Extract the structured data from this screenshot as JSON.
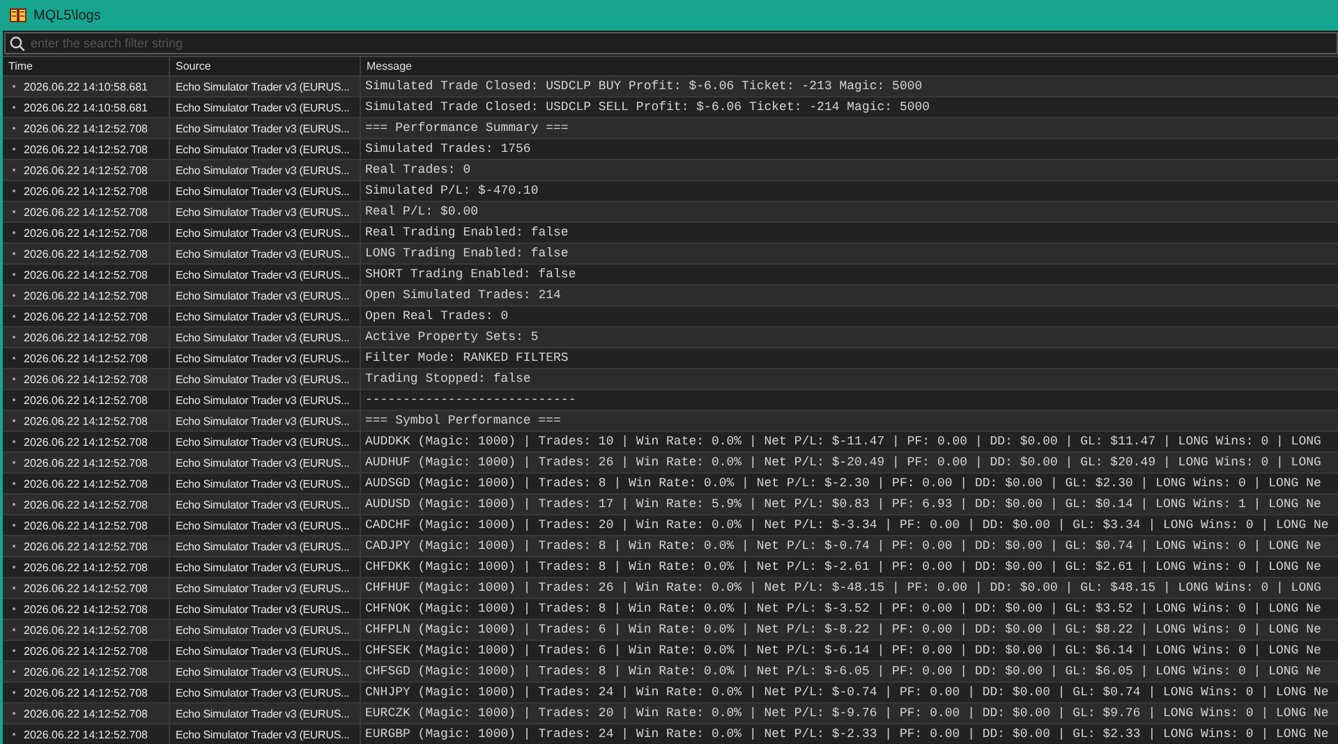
{
  "window": {
    "title": "MQL5\\logs"
  },
  "search": {
    "placeholder": "enter the search filter string"
  },
  "table": {
    "columns": [
      "Time",
      "Source",
      "Message"
    ],
    "rows": [
      {
        "time": "2026.06.22 14:10:58.681",
        "source": "Echo Simulator Trader v3 (EURUS...",
        "message": "Simulated Trade Closed: USDCLP BUY Profit: $-6.06 Ticket: -213 Magic: 5000"
      },
      {
        "time": "2026.06.22 14:10:58.681",
        "source": "Echo Simulator Trader v3 (EURUS...",
        "message": "Simulated Trade Closed: USDCLP SELL Profit: $-6.06 Ticket: -214 Magic: 5000"
      },
      {
        "time": "2026.06.22 14:12:52.708",
        "source": "Echo Simulator Trader v3 (EURUS...",
        "message": "=== Performance Summary ==="
      },
      {
        "time": "2026.06.22 14:12:52.708",
        "source": "Echo Simulator Trader v3 (EURUS...",
        "message": "Simulated Trades: 1756"
      },
      {
        "time": "2026.06.22 14:12:52.708",
        "source": "Echo Simulator Trader v3 (EURUS...",
        "message": "Real Trades: 0"
      },
      {
        "time": "2026.06.22 14:12:52.708",
        "source": "Echo Simulator Trader v3 (EURUS...",
        "message": "Simulated P/L: $-470.10"
      },
      {
        "time": "2026.06.22 14:12:52.708",
        "source": "Echo Simulator Trader v3 (EURUS...",
        "message": "Real P/L: $0.00"
      },
      {
        "time": "2026.06.22 14:12:52.708",
        "source": "Echo Simulator Trader v3 (EURUS...",
        "message": "Real Trading Enabled: false"
      },
      {
        "time": "2026.06.22 14:12:52.708",
        "source": "Echo Simulator Trader v3 (EURUS...",
        "message": "LONG Trading Enabled: false"
      },
      {
        "time": "2026.06.22 14:12:52.708",
        "source": "Echo Simulator Trader v3 (EURUS...",
        "message": "SHORT Trading Enabled: false"
      },
      {
        "time": "2026.06.22 14:12:52.708",
        "source": "Echo Simulator Trader v3 (EURUS...",
        "message": "Open Simulated Trades: 214"
      },
      {
        "time": "2026.06.22 14:12:52.708",
        "source": "Echo Simulator Trader v3 (EURUS...",
        "message": "Open Real Trades: 0"
      },
      {
        "time": "2026.06.22 14:12:52.708",
        "source": "Echo Simulator Trader v3 (EURUS...",
        "message": "Active Property Sets: 5"
      },
      {
        "time": "2026.06.22 14:12:52.708",
        "source": "Echo Simulator Trader v3 (EURUS...",
        "message": "Filter Mode: RANKED FILTERS"
      },
      {
        "time": "2026.06.22 14:12:52.708",
        "source": "Echo Simulator Trader v3 (EURUS...",
        "message": "Trading Stopped: false"
      },
      {
        "time": "2026.06.22 14:12:52.708",
        "source": "Echo Simulator Trader v3 (EURUS...",
        "message": "----------------------------"
      },
      {
        "time": "2026.06.22 14:12:52.708",
        "source": "Echo Simulator Trader v3 (EURUS...",
        "message": "=== Symbol Performance ==="
      },
      {
        "time": "2026.06.22 14:12:52.708",
        "source": "Echo Simulator Trader v3 (EURUS...",
        "message": "AUDDKK (Magic: 1000) | Trades: 10 | Win Rate: 0.0% | Net P/L: $-11.47 | PF: 0.00 | DD: $0.00 | GL: $11.47 | LONG Wins: 0 | LONG"
      },
      {
        "time": "2026.06.22 14:12:52.708",
        "source": "Echo Simulator Trader v3 (EURUS...",
        "message": "AUDHUF (Magic: 1000) | Trades: 26 | Win Rate: 0.0% | Net P/L: $-20.49 | PF: 0.00 | DD: $0.00 | GL: $20.49 | LONG Wins: 0 | LONG"
      },
      {
        "time": "2026.06.22 14:12:52.708",
        "source": "Echo Simulator Trader v3 (EURUS...",
        "message": "AUDSGD (Magic: 1000) | Trades: 8 | Win Rate: 0.0% | Net P/L: $-2.30 | PF: 0.00 | DD: $0.00 | GL: $2.30 | LONG Wins: 0 | LONG Ne"
      },
      {
        "time": "2026.06.22 14:12:52.708",
        "source": "Echo Simulator Trader v3 (EURUS...",
        "message": "AUDUSD (Magic: 1000) | Trades: 17 | Win Rate: 5.9% | Net P/L: $0.83 | PF: 6.93 | DD: $0.00 | GL: $0.14 | LONG Wins: 1 | LONG Ne"
      },
      {
        "time": "2026.06.22 14:12:52.708",
        "source": "Echo Simulator Trader v3 (EURUS...",
        "message": "CADCHF (Magic: 1000) | Trades: 20 | Win Rate: 0.0% | Net P/L: $-3.34 | PF: 0.00 | DD: $0.00 | GL: $3.34 | LONG Wins: 0 | LONG Ne"
      },
      {
        "time": "2026.06.22 14:12:52.708",
        "source": "Echo Simulator Trader v3 (EURUS...",
        "message": "CADJPY (Magic: 1000) | Trades: 8 | Win Rate: 0.0% | Net P/L: $-0.74 | PF: 0.00 | DD: $0.00 | GL: $0.74 | LONG Wins: 0 | LONG Ne"
      },
      {
        "time": "2026.06.22 14:12:52.708",
        "source": "Echo Simulator Trader v3 (EURUS...",
        "message": "CHFDKK (Magic: 1000) | Trades: 8 | Win Rate: 0.0% | Net P/L: $-2.61 | PF: 0.00 | DD: $0.00 | GL: $2.61 | LONG Wins: 0 | LONG Ne"
      },
      {
        "time": "2026.06.22 14:12:52.708",
        "source": "Echo Simulator Trader v3 (EURUS...",
        "message": "CHFHUF (Magic: 1000) | Trades: 26 | Win Rate: 0.0% | Net P/L: $-48.15 | PF: 0.00 | DD: $0.00 | GL: $48.15 | LONG Wins: 0 | LONG"
      },
      {
        "time": "2026.06.22 14:12:52.708",
        "source": "Echo Simulator Trader v3 (EURUS...",
        "message": "CHFNOK (Magic: 1000) | Trades: 8 | Win Rate: 0.0% | Net P/L: $-3.52 | PF: 0.00 | DD: $0.00 | GL: $3.52 | LONG Wins: 0 | LONG Ne"
      },
      {
        "time": "2026.06.22 14:12:52.708",
        "source": "Echo Simulator Trader v3 (EURUS...",
        "message": "CHFPLN (Magic: 1000) | Trades: 6 | Win Rate: 0.0% | Net P/L: $-8.22 | PF: 0.00 | DD: $0.00 | GL: $8.22 | LONG Wins: 0 | LONG Ne"
      },
      {
        "time": "2026.06.22 14:12:52.708",
        "source": "Echo Simulator Trader v3 (EURUS...",
        "message": "CHFSEK (Magic: 1000) | Trades: 6 | Win Rate: 0.0% | Net P/L: $-6.14 | PF: 0.00 | DD: $0.00 | GL: $6.14 | LONG Wins: 0 | LONG Ne"
      },
      {
        "time": "2026.06.22 14:12:52.708",
        "source": "Echo Simulator Trader v3 (EURUS...",
        "message": "CHFSGD (Magic: 1000) | Trades: 8 | Win Rate: 0.0% | Net P/L: $-6.05 | PF: 0.00 | DD: $0.00 | GL: $6.05 | LONG Wins: 0 | LONG Ne"
      },
      {
        "time": "2026.06.22 14:12:52.708",
        "source": "Echo Simulator Trader v3 (EURUS...",
        "message": "CNHJPY (Magic: 1000) | Trades: 24 | Win Rate: 0.0% | Net P/L: $-0.74 | PF: 0.00 | DD: $0.00 | GL: $0.74 | LONG Wins: 0 | LONG Ne"
      },
      {
        "time": "2026.06.22 14:12:52.708",
        "source": "Echo Simulator Trader v3 (EURUS...",
        "message": "EURCZK (Magic: 1000) | Trades: 20 | Win Rate: 0.0% | Net P/L: $-9.76 | PF: 0.00 | DD: $0.00 | GL: $9.76 | LONG Wins: 0 | LONG Ne"
      },
      {
        "time": "2026.06.22 14:12:52.708",
        "source": "Echo Simulator Trader v3 (EURUS...",
        "message": "EURGBP (Magic: 1000) | Trades: 24 | Win Rate: 0.0% | Net P/L: $-2.33 | PF: 0.00 | DD: $0.00 | GL: $2.33 | LONG Wins: 0 | LONG Ne"
      }
    ]
  }
}
